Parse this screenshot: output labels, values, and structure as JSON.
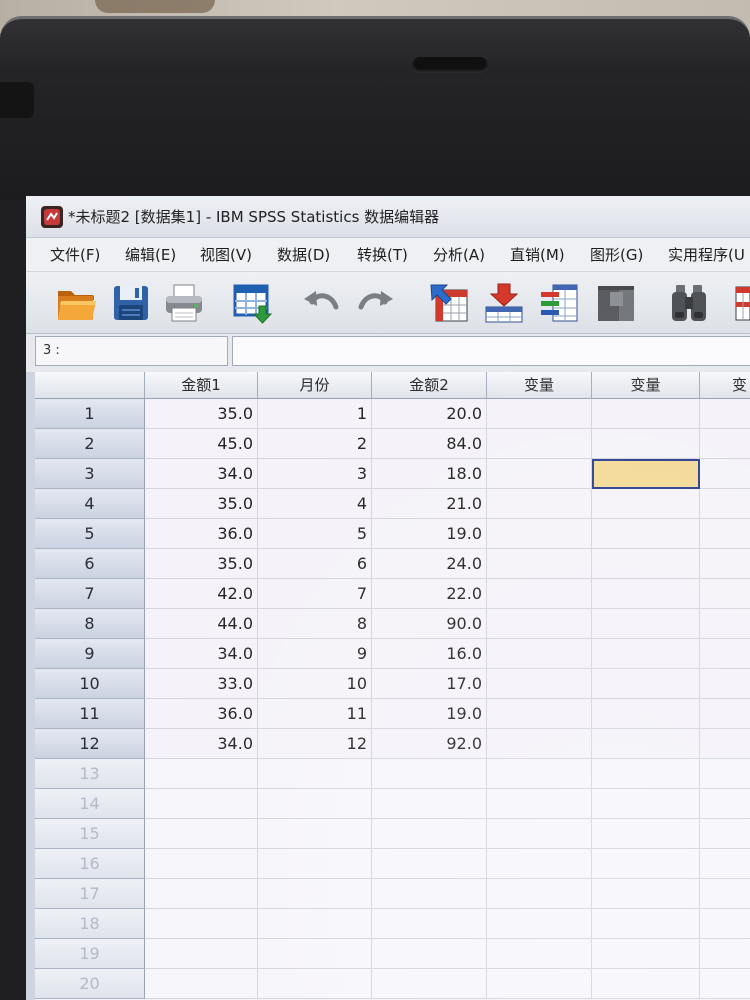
{
  "window": {
    "title": "*未标题2 [数据集1] - IBM SPSS Statistics 数据编辑器"
  },
  "menu": [
    "文件(F)",
    "编辑(E)",
    "视图(V)",
    "数据(D)",
    "转换(T)",
    "分析(A)",
    "直销(M)",
    "图形(G)",
    "实用程序(U"
  ],
  "toolbar": [
    "open-folder-icon",
    "save-icon",
    "print-icon",
    "recall-dialog-icon",
    "undo-icon",
    "redo-icon",
    "go-to-case-icon",
    "go-to-variable-icon",
    "variables-icon",
    "descriptive-statistics-icon",
    "find-icon",
    "insert-cases-icon"
  ],
  "cell_editor": {
    "ref": "3 :",
    "value": ""
  },
  "grid": {
    "columns": [
      "金额1",
      "月份",
      "金额2",
      "变量",
      "变量",
      "变"
    ],
    "row_labels": [
      "1",
      "2",
      "3",
      "4",
      "5",
      "6",
      "7",
      "8",
      "9",
      "10",
      "11",
      "12",
      "13",
      "14",
      "15",
      "16",
      "17",
      "18",
      "19",
      "20"
    ],
    "data_rows": [
      [
        "35.0",
        "1",
        "20.0"
      ],
      [
        "45.0",
        "2",
        "84.0"
      ],
      [
        "34.0",
        "3",
        "18.0"
      ],
      [
        "35.0",
        "4",
        "21.0"
      ],
      [
        "36.0",
        "5",
        "19.0"
      ],
      [
        "35.0",
        "6",
        "24.0"
      ],
      [
        "42.0",
        "7",
        "22.0"
      ],
      [
        "44.0",
        "8",
        "90.0"
      ],
      [
        "34.0",
        "9",
        "16.0"
      ],
      [
        "33.0",
        "10",
        "17.0"
      ],
      [
        "36.0",
        "11",
        "19.0"
      ],
      [
        "34.0",
        "12",
        "92.0"
      ]
    ],
    "selected_cell": {
      "row": 3,
      "column": 5
    }
  },
  "colors": {
    "selected_cell_fill": "#f2da98",
    "selected_cell_border": "#2b3f8f"
  }
}
